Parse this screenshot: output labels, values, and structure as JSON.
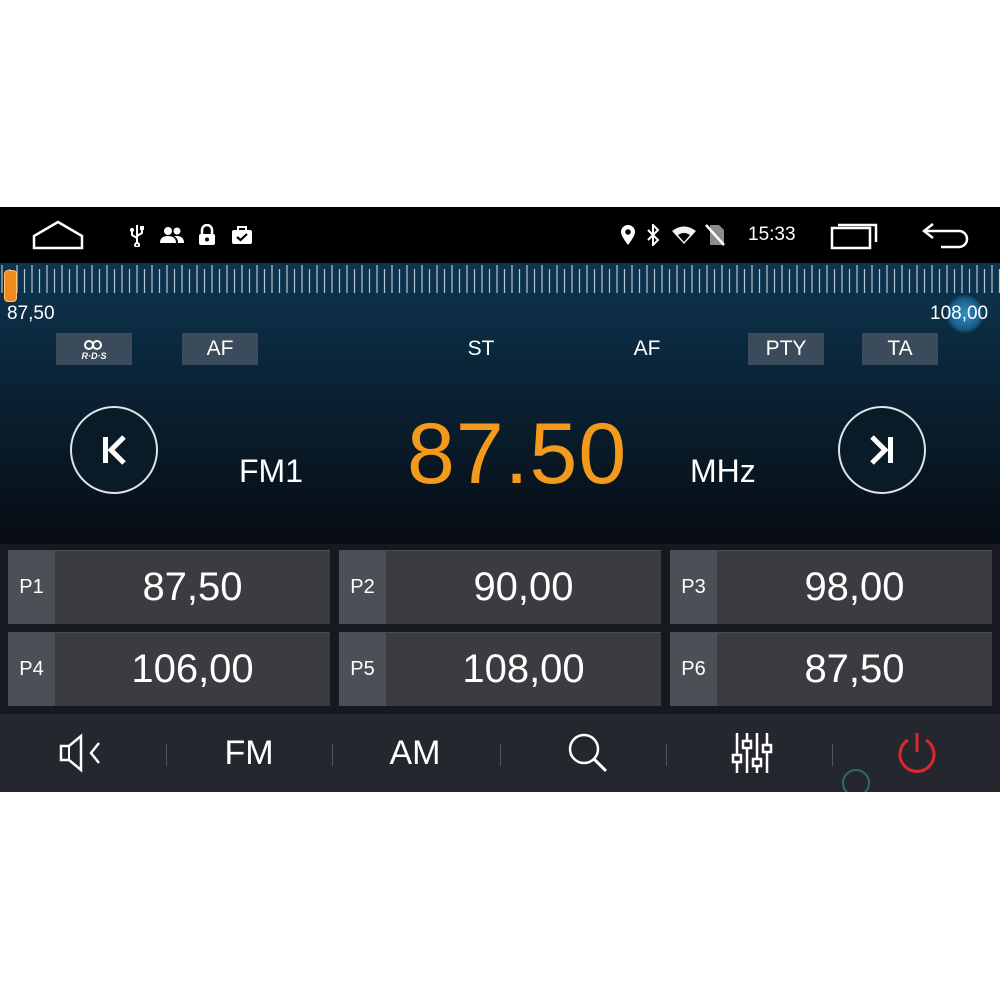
{
  "status_bar": {
    "time": "15:33",
    "left_icons": [
      "home-icon",
      "usb-icon",
      "people-icon",
      "lock-icon",
      "briefcase-icon"
    ],
    "right_icons": [
      "location-icon",
      "bluetooth-icon",
      "wifi-icon",
      "no-sim-icon",
      "recent-apps-icon",
      "back-icon"
    ]
  },
  "tuner": {
    "scale_min_label": "87,50",
    "scale_max_label": "108,00",
    "tags": {
      "rds": "R·D·S",
      "af_button": "AF",
      "st_indicator": "ST",
      "af_indicator": "AF",
      "pty_button": "PTY",
      "ta_button": "TA"
    },
    "band": "FM1",
    "frequency": "87.50",
    "unit": "MHz",
    "prev_icon": "seek-back-icon",
    "next_icon": "seek-forward-icon"
  },
  "presets": [
    {
      "label": "P1",
      "value": "87,50"
    },
    {
      "label": "P2",
      "value": "90,00"
    },
    {
      "label": "P3",
      "value": "98,00"
    },
    {
      "label": "P4",
      "value": "106,00"
    },
    {
      "label": "P5",
      "value": "108,00"
    },
    {
      "label": "P6",
      "value": "87,50"
    }
  ],
  "bottom_bar": {
    "mute_icon": "speaker-mute-icon",
    "fm": "FM",
    "am": "AM",
    "search_icon": "search-icon",
    "eq_icon": "equalizer-icon",
    "power_icon": "power-icon"
  },
  "colors": {
    "frequency": "#f39a1d",
    "power": "#e0262b",
    "needle": "#f08a1c"
  }
}
